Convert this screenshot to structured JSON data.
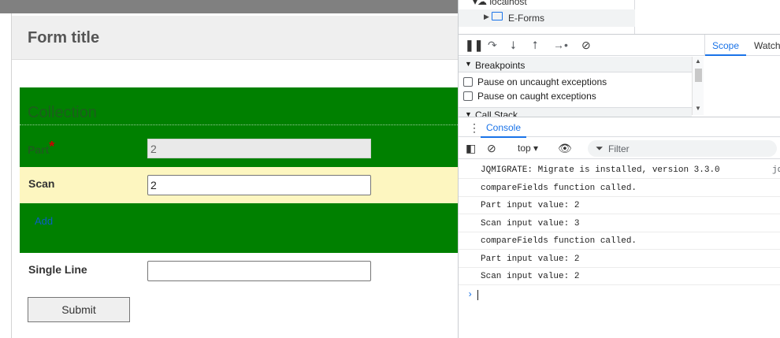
{
  "form": {
    "title": "Form title",
    "collection_heading": "Collection",
    "part_label": "Part",
    "required_mark": "*",
    "part_value": "2",
    "scan_label": "Scan",
    "scan_value": "2",
    "add_label": "Add",
    "single_line_label": "Single Line",
    "single_line_value": "",
    "submit_label": "Submit"
  },
  "devtools": {
    "tree": {
      "host": "localhost",
      "folder": "E-Forms"
    },
    "side_tabs": {
      "scope": "Scope",
      "watch": "Watch"
    },
    "breakpoints": {
      "header": "Breakpoints",
      "options": [
        "Pause on uncaught exceptions",
        "Pause on caught exceptions"
      ]
    },
    "call_stack_header": "Call Stack",
    "console_tab": "Console",
    "context": "top",
    "filter_placeholder": "Filter",
    "logs": [
      {
        "text": "JQMIGRATE: Migrate is installed, version 3.3.0",
        "source": "jq"
      },
      {
        "text": "compareFields function called.",
        "source": ""
      },
      {
        "text": "Part input value: 2",
        "source": ""
      },
      {
        "text": "Scan input value: 3",
        "source": ""
      },
      {
        "text": "compareFields function called.",
        "source": ""
      },
      {
        "text": "Part input value: 2",
        "source": ""
      },
      {
        "text": "Scan input value: 2",
        "source": ""
      }
    ],
    "prompt_glyph": "›"
  },
  "colors": {
    "collection_bg": "#008000",
    "scan_row_bg": "#fdf6c0",
    "accent": "#1a73e8"
  }
}
